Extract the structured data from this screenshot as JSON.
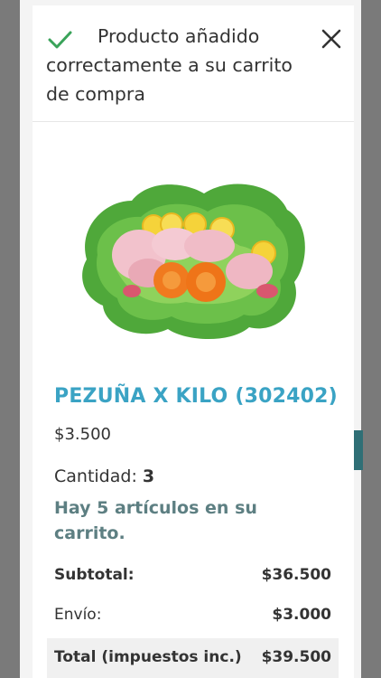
{
  "header": {
    "message": "Producto añadido correctamente a su carrito de compra",
    "check_icon": "check-icon",
    "close_icon": "close-icon",
    "accent": "#3aa35a"
  },
  "product": {
    "title": "PEZUÑA X KILO (302402)",
    "price": "$3.500",
    "image_icon": "product-image",
    "title_color": "#3aa3c4"
  },
  "quantity": {
    "label": "Cantidad:",
    "value": "3"
  },
  "cart": {
    "items_message": "Hay 5 artículos en su carrito."
  },
  "summary": {
    "subtotal_label": "Subtotal:",
    "subtotal_value": "$36.500",
    "shipping_label": "Envío:",
    "shipping_value": "$3.000",
    "total_label": "Total (impuestos inc.)",
    "total_value": "$39.500"
  }
}
